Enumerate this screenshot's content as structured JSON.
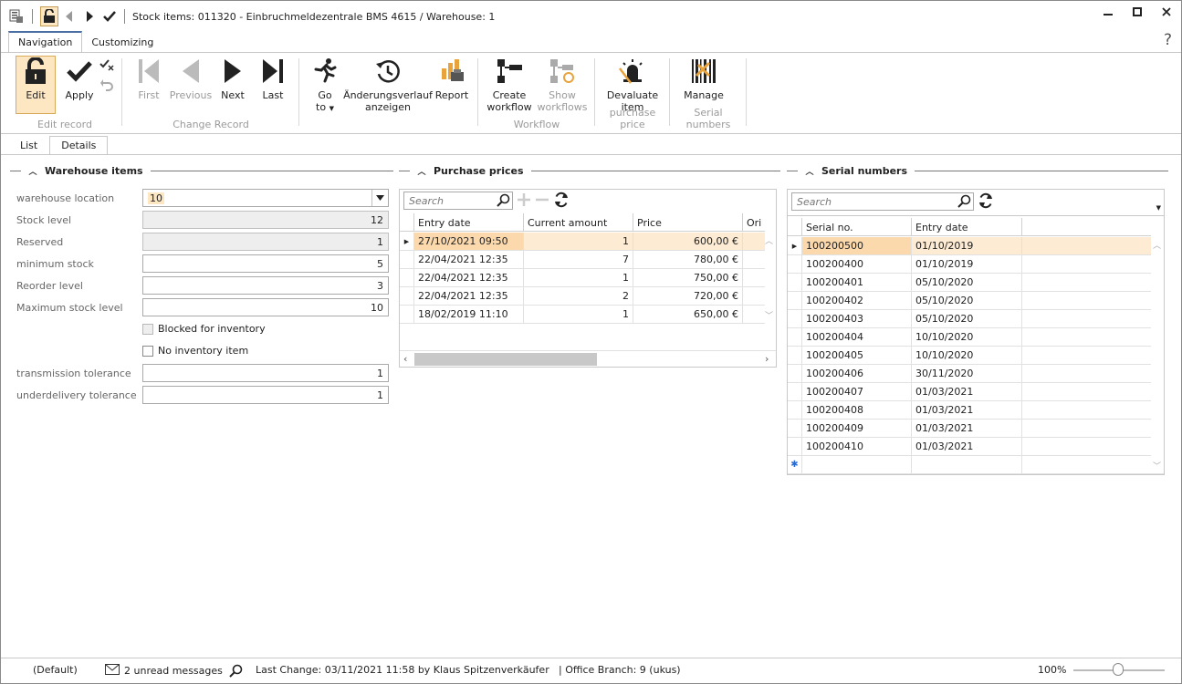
{
  "window": {
    "title": "Stock items: 011320 - Einbruchmeldezentrale BMS 4615 / Warehouse: 1"
  },
  "ribbon_tabs": [
    {
      "label": "Navigation",
      "active": true
    },
    {
      "label": "Customizing",
      "active": false
    }
  ],
  "help_label": "?",
  "ribbon": {
    "edit_record": {
      "label": "Edit record",
      "edit": "Edit",
      "apply": "Apply"
    },
    "change_record": {
      "label": "Change Record",
      "first": "First",
      "previous": "Previous",
      "next": "Next",
      "last": "Last"
    },
    "misc": {
      "goto_line1": "Go",
      "goto_line2": "to",
      "history_line1": "Änderungsverlauf",
      "history_line2": "anzeigen",
      "report": "Report"
    },
    "workflow": {
      "label": "Workflow",
      "create_line1": "Create",
      "create_line2": "workflow",
      "show_line1": "Show",
      "show_line2": "workflows"
    },
    "purchase_price": {
      "label": "purchase price",
      "devaluate_line1": "Devaluate",
      "devaluate_line2": "item"
    },
    "serial_numbers": {
      "label": "Serial numbers",
      "manage": "Manage"
    }
  },
  "page_tabs": [
    {
      "label": "List",
      "active": false
    },
    {
      "label": "Details",
      "active": true
    }
  ],
  "warehouse_items": {
    "title": "Warehouse items",
    "warehouse_location_label": "warehouse location",
    "warehouse_location_value": "10",
    "stock_level_label": "Stock level",
    "stock_level_value": "12",
    "reserved_label": "Reserved",
    "reserved_value": "1",
    "minimum_stock_label": "minimum stock",
    "minimum_stock_value": "5",
    "reorder_level_label": "Reorder level",
    "reorder_level_value": "3",
    "maximum_stock_label": "Maximum stock level",
    "maximum_stock_value": "10",
    "blocked_label": "Blocked for inventory",
    "no_inventory_label": "No inventory item",
    "transmission_tolerance_label": "transmission tolerance",
    "transmission_tolerance_value": "1",
    "underdelivery_tolerance_label": "underdelivery tolerance",
    "underdelivery_tolerance_value": "1"
  },
  "purchase_prices": {
    "title": "Purchase prices",
    "search_placeholder": "Search",
    "columns": [
      "Entry date",
      "Current amount",
      "Price",
      "Ori"
    ],
    "rows": [
      {
        "date": "27/10/2021 09:50",
        "amount": "1",
        "price": "600,00 €"
      },
      {
        "date": "22/04/2021 12:35",
        "amount": "7",
        "price": "780,00 €"
      },
      {
        "date": "22/04/2021 12:35",
        "amount": "1",
        "price": "750,00 €"
      },
      {
        "date": "22/04/2021 12:35",
        "amount": "2",
        "price": "720,00 €"
      },
      {
        "date": "18/02/2019 11:10",
        "amount": "1",
        "price": "650,00 €"
      }
    ]
  },
  "serial_numbers": {
    "title": "Serial numbers",
    "search_placeholder": "Search",
    "columns": [
      "Serial no.",
      "Entry date"
    ],
    "rows": [
      {
        "serial": "100200500",
        "date": "01/10/2019"
      },
      {
        "serial": "100200400",
        "date": "01/10/2019"
      },
      {
        "serial": "100200401",
        "date": "05/10/2020"
      },
      {
        "serial": "100200402",
        "date": "05/10/2020"
      },
      {
        "serial": "100200403",
        "date": "05/10/2020"
      },
      {
        "serial": "100200404",
        "date": "10/10/2020"
      },
      {
        "serial": "100200405",
        "date": "10/10/2020"
      },
      {
        "serial": "100200406",
        "date": "30/11/2020"
      },
      {
        "serial": "100200407",
        "date": "01/03/2021"
      },
      {
        "serial": "100200408",
        "date": "01/03/2021"
      },
      {
        "serial": "100200409",
        "date": "01/03/2021"
      },
      {
        "serial": "100200410",
        "date": "01/03/2021"
      }
    ]
  },
  "status_bar": {
    "layout": "(Default)",
    "messages": "2 unread messages",
    "last_change": "Last Change: 03/11/2021 11:58 by Klaus Spitzenverkäufer",
    "office_branch": "| Office Branch:  9 (ukus)",
    "zoom": "100%"
  },
  "colors": {
    "accent_orange": "#e8a33c",
    "selection": "#fde7c3",
    "disabled_text": "#9a9a9a"
  }
}
